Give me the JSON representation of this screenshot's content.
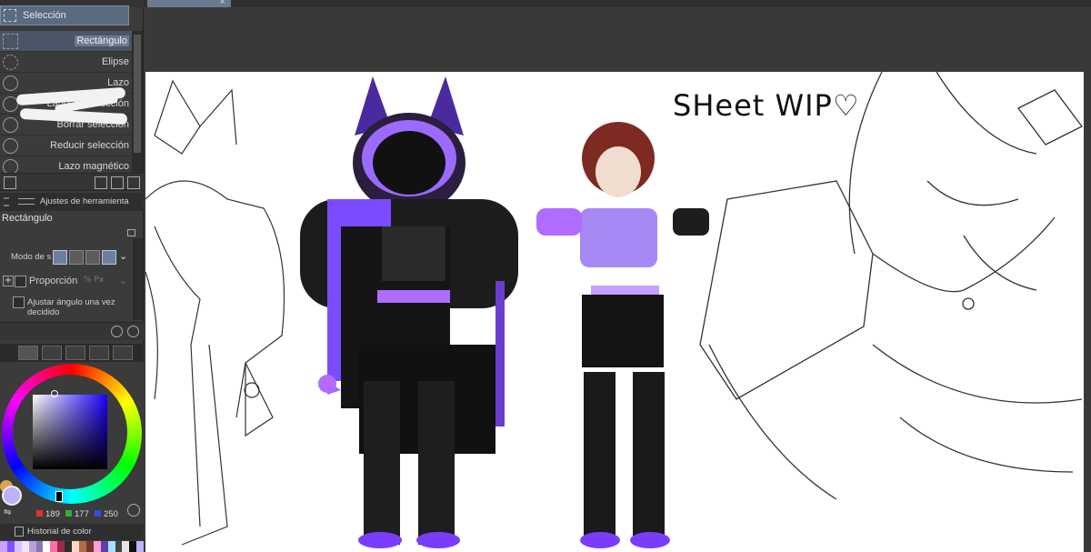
{
  "subtool": {
    "active_label": "Selección"
  },
  "tools": [
    {
      "label": "Rectángulo",
      "selected": true
    },
    {
      "label": "Elipse"
    },
    {
      "label": "Lazo"
    },
    {
      "label": "Lápiz de selección"
    },
    {
      "label": "Borrar selección"
    },
    {
      "label": "Reducir selección"
    },
    {
      "label": "Lazo magnético"
    }
  ],
  "tool_property": {
    "header": "Ajustes de herramienta",
    "title": "Rectángulo",
    "mode_label": "Modo de s",
    "proportion_label": "Proporción",
    "angle_label": "Ajustar ángulo una vez decidido"
  },
  "color": {
    "main_color": "#bdb1fa",
    "sub_color": "#d9a550",
    "r": "189",
    "g": "177",
    "b": "250"
  },
  "history": {
    "label": "Historial de color"
  },
  "palette_colors": [
    "#c9a0ff",
    "#7c52ff",
    "#d7c3ff",
    "#f2e6ff",
    "#b7a2d6",
    "#8a78b0",
    "#ffffff",
    "#ff6fa8",
    "#9b2c47",
    "#2d2d2d",
    "#ffd6c4",
    "#b06a4c",
    "#6d3a2a",
    "#ff9fd9",
    "#5f3ea8",
    "#a7e0ff",
    "#444",
    "#e6e6e6",
    "#111",
    "#bdb1fa"
  ],
  "canvas": {
    "title": "SHeet WIP♡"
  }
}
